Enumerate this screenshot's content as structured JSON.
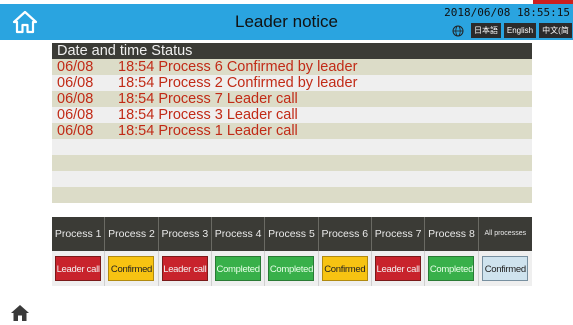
{
  "header": {
    "title": "Leader notice",
    "datetime": "2018/06/08 18:55:15",
    "languages": [
      "日本語",
      "English",
      "中文(简体)"
    ],
    "background_color": "#2aa4e0",
    "home_icon": "home-icon",
    "globe_icon": "globe-icon"
  },
  "notices": {
    "header": "Date and time Status",
    "rows": [
      {
        "date": "06/08",
        "time": "18:54",
        "message": "Process 6 Confirmed by leader"
      },
      {
        "date": "06/08",
        "time": "18:54",
        "message": "Process 2 Confirmed by leader"
      },
      {
        "date": "06/08",
        "time": "18:54",
        "message": "Process 7 Leader call"
      },
      {
        "date": "06/08",
        "time": "18:54",
        "message": "Process 3 Leader call"
      },
      {
        "date": "06/08",
        "time": "18:54",
        "message": "Process 1 Leader call"
      },
      {
        "date": "",
        "time": "",
        "message": ""
      },
      {
        "date": "",
        "time": "",
        "message": ""
      },
      {
        "date": "",
        "time": "",
        "message": ""
      },
      {
        "date": "",
        "time": "",
        "message": ""
      }
    ],
    "text_color": "#c12a16"
  },
  "processes": {
    "headers": [
      "Process 1",
      "Process 2",
      "Process 3",
      "Process 4",
      "Process 5",
      "Process 6",
      "Process 7",
      "Process 8",
      "All processes"
    ],
    "statuses": [
      {
        "label": "Leader call",
        "kind": "leader"
      },
      {
        "label": "Confirmed",
        "kind": "confirmed"
      },
      {
        "label": "Leader call",
        "kind": "leader"
      },
      {
        "label": "Completed",
        "kind": "completed"
      },
      {
        "label": "Completed",
        "kind": "completed"
      },
      {
        "label": "Confirmed",
        "kind": "confirmed"
      },
      {
        "label": "Leader call",
        "kind": "leader"
      },
      {
        "label": "Completed",
        "kind": "completed"
      },
      {
        "label": "Confirmed",
        "kind": "confirmed-light"
      }
    ],
    "status_colors": {
      "leader": "#c8232c",
      "confirmed": "#f7c312",
      "completed": "#38b04a",
      "confirmed-light": "#cfe3ee"
    }
  },
  "footer": {
    "home_icon": "home-icon"
  }
}
